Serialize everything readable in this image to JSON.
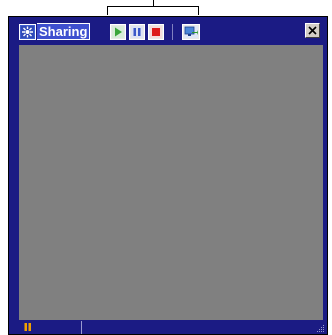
{
  "window": {
    "title": "Sharing"
  },
  "toolbar": {
    "buttons": [
      {
        "name": "play",
        "icon": "play-icon",
        "color": "#3aa63a"
      },
      {
        "name": "pause",
        "icon": "pause-icon",
        "color": "#3a57c8"
      },
      {
        "name": "stop",
        "icon": "stop-icon",
        "color": "#dd1a1a"
      },
      {
        "name": "share",
        "icon": "share-screen-icon"
      }
    ]
  },
  "titlebar": {
    "close_icon": "close-icon"
  },
  "statusbar": {
    "state_icon": "pause-icon",
    "state_color": "#f0a000"
  },
  "colors": {
    "frame": "#1b1b84",
    "viewport": "#808080"
  }
}
